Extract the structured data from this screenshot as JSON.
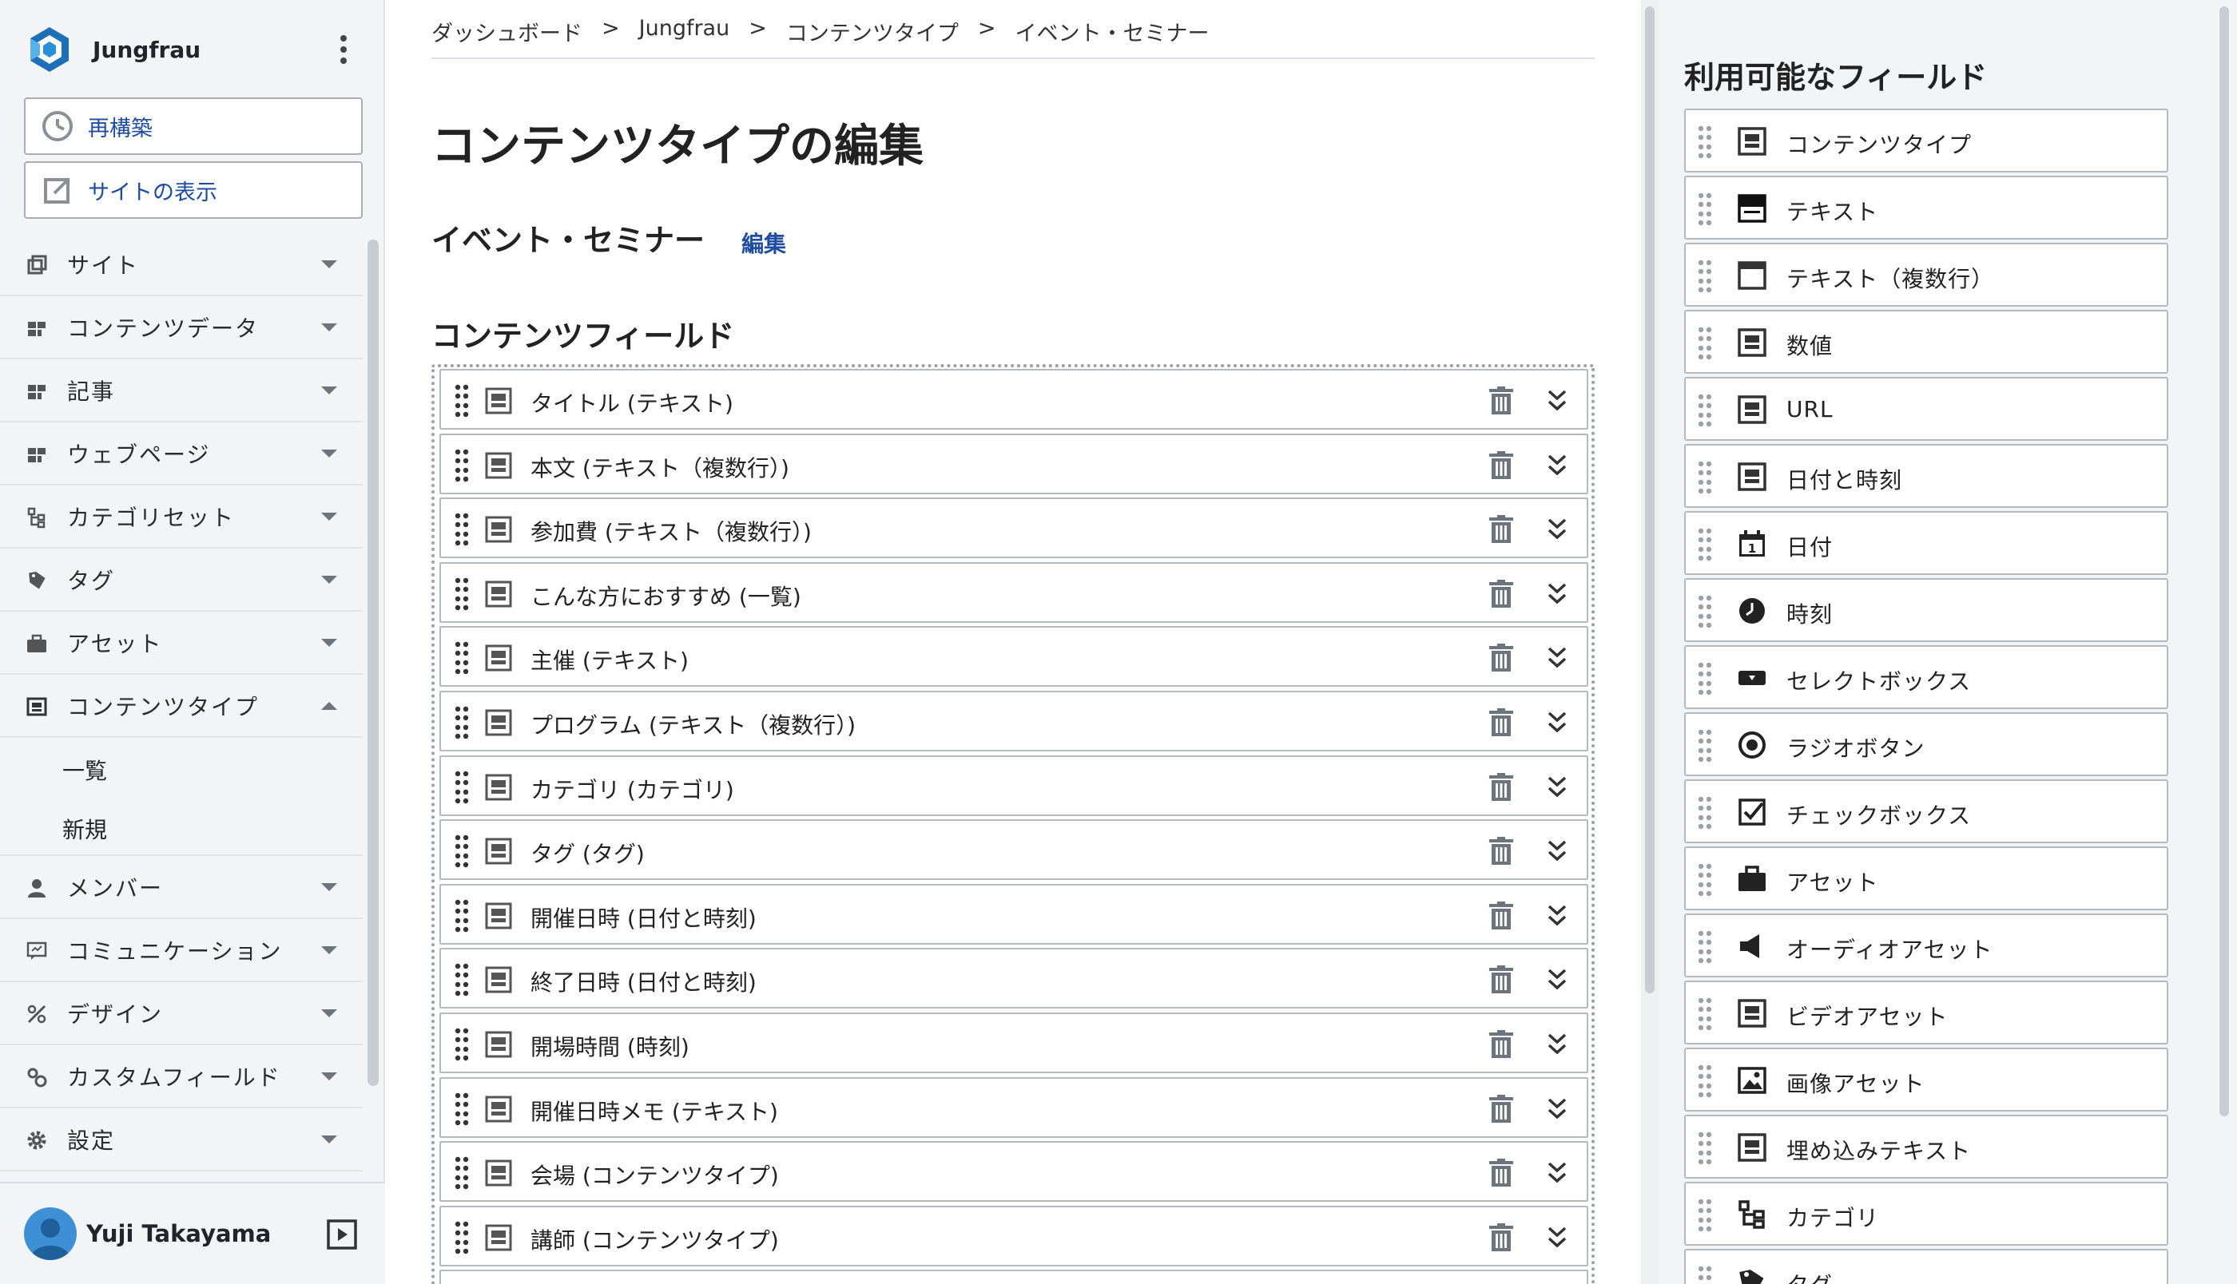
{
  "brand": {
    "name": "Jungfrau"
  },
  "sidebar": {
    "rebuild_label": "再構築",
    "view_site_label": "サイトの表示",
    "items": [
      {
        "label": "サイト",
        "icon": "sites-icon"
      },
      {
        "label": "コンテンツデータ",
        "icon": "grid-icon"
      },
      {
        "label": "記事",
        "icon": "grid-icon"
      },
      {
        "label": "ウェブページ",
        "icon": "grid-icon"
      },
      {
        "label": "カテゴリセット",
        "icon": "hierarchy-icon"
      },
      {
        "label": "タグ",
        "icon": "tag-icon"
      },
      {
        "label": "アセット",
        "icon": "briefcase-icon"
      },
      {
        "label": "コンテンツタイプ",
        "icon": "content-type-icon",
        "expanded": true
      },
      {
        "label": "メンバー",
        "icon": "member-icon"
      },
      {
        "label": "コミュニケーション",
        "icon": "chat-icon"
      },
      {
        "label": "デザイン",
        "icon": "design-icon"
      },
      {
        "label": "カスタムフィールド",
        "icon": "gears-icon"
      },
      {
        "label": "設定",
        "icon": "gear-icon"
      }
    ],
    "sub_items": [
      "一覧",
      "新規"
    ]
  },
  "user": {
    "name": "Yuji Takayama"
  },
  "breadcrumb": [
    "ダッシュボード",
    ">",
    "Jungfrau",
    ">",
    "コンテンツタイプ",
    ">",
    "イベント・セミナー"
  ],
  "page": {
    "title": "コンテンツタイプの編集",
    "content_type_name": "イベント・セミナー",
    "edit_label": "編集",
    "fields_section_title": "コンテンツフィールド"
  },
  "fields": [
    "タイトル (テキスト)",
    "本文 (テキスト（複数行）)",
    "参加費 (テキスト（複数行）)",
    "こんな方におすすめ (一覧)",
    "主催 (テキスト)",
    "プログラム (テキスト（複数行）)",
    "カテゴリ (カテゴリ)",
    "タグ (タグ)",
    "開催日時 (日付と時刻)",
    "終了日時 (日付と時刻)",
    "開場時間 (時刻)",
    "開催日時メモ (テキスト)",
    "会場 (コンテンツタイプ)",
    "講師 (コンテンツタイプ)",
    ""
  ],
  "available": {
    "title": "利用可能なフィールド",
    "items": [
      {
        "label": "コンテンツタイプ",
        "icon": "content-type-icon"
      },
      {
        "label": "テキスト",
        "icon": "text-icon"
      },
      {
        "label": "テキスト（複数行）",
        "icon": "multiline-text-icon"
      },
      {
        "label": "数値",
        "icon": "number-icon"
      },
      {
        "label": "URL",
        "icon": "url-icon"
      },
      {
        "label": "日付と時刻",
        "icon": "datetime-icon"
      },
      {
        "label": "日付",
        "icon": "calendar-icon"
      },
      {
        "label": "時刻",
        "icon": "clock-icon"
      },
      {
        "label": "セレクトボックス",
        "icon": "select-icon"
      },
      {
        "label": "ラジオボタン",
        "icon": "radio-icon"
      },
      {
        "label": "チェックボックス",
        "icon": "checkbox-icon"
      },
      {
        "label": "アセット",
        "icon": "briefcase-icon"
      },
      {
        "label": "オーディオアセット",
        "icon": "audio-icon"
      },
      {
        "label": "ビデオアセット",
        "icon": "video-icon"
      },
      {
        "label": "画像アセット",
        "icon": "image-icon"
      },
      {
        "label": "埋め込みテキスト",
        "icon": "embed-icon"
      },
      {
        "label": "カテゴリ",
        "icon": "hierarchy-icon"
      },
      {
        "label": "タグ",
        "icon": "tag-icon"
      }
    ]
  }
}
